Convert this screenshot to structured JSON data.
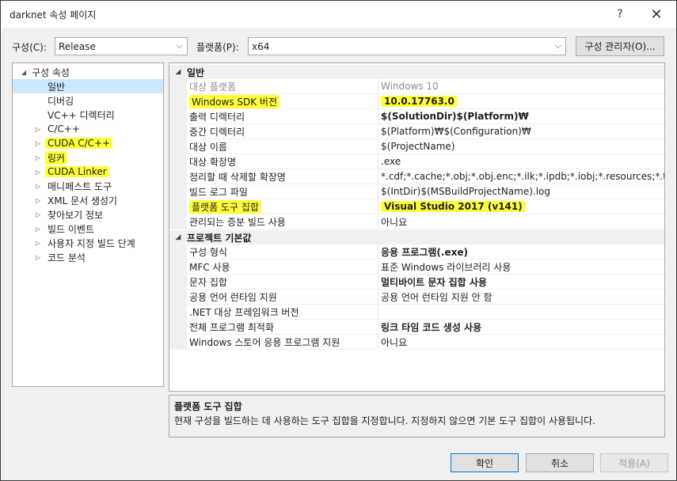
{
  "window": {
    "title": "darknet 속성 페이지",
    "help": "?",
    "close": "✕"
  },
  "config": {
    "config_label": "구성(C):",
    "config_value": "Release",
    "platform_label": "플랫폼(P):",
    "platform_value": "x64",
    "manager_button": "구성 관리자(O)..."
  },
  "tree": {
    "root": "구성 속성",
    "items": [
      {
        "label": "일반"
      },
      {
        "label": "디버깅"
      },
      {
        "label": "VC++ 디렉터리"
      },
      {
        "label": "C/C++"
      },
      {
        "label": "CUDA C/C++"
      },
      {
        "label": "링커"
      },
      {
        "label": "CUDA Linker"
      },
      {
        "label": "매니페스트 도구"
      },
      {
        "label": "XML 문서 생성기"
      },
      {
        "label": "찾아보기 정보"
      },
      {
        "label": "빌드 이벤트"
      },
      {
        "label": "사용자 지정 빌드 단계"
      },
      {
        "label": "코드 분석"
      }
    ]
  },
  "grid": {
    "categories": [
      {
        "name": "일반",
        "props": [
          {
            "name": "대상 플랫폼",
            "value": "Windows 10"
          },
          {
            "name": "Windows SDK 버전",
            "value": "10.0.17763.0"
          },
          {
            "name": "출력 디렉터리",
            "value": "$(SolutionDir)$(Platform)₩"
          },
          {
            "name": "중간 디렉터리",
            "value": "$(Platform)₩$(Configuration)₩"
          },
          {
            "name": "대상 이름",
            "value": "$(ProjectName)"
          },
          {
            "name": "대상 확장명",
            "value": ".exe"
          },
          {
            "name": "정리할 때 삭제할 확장명",
            "value": "*.cdf;*.cache;*.obj;*.obj.enc;*.ilk;*.ipdb;*.iobj;*.resources;*.tlb;*.tli;*.tl"
          },
          {
            "name": "빌드 로그 파일",
            "value": "$(IntDir)$(MSBuildProjectName).log"
          },
          {
            "name": "플랫폼 도구 집합",
            "value": "Visual Studio 2017 (v141)"
          },
          {
            "name": "관리되는 증분 빌드 사용",
            "value": "아니요"
          }
        ]
      },
      {
        "name": "프로젝트 기본값",
        "props": [
          {
            "name": "구성 형식",
            "value": "응용 프로그램(.exe)"
          },
          {
            "name": "MFC 사용",
            "value": "표준 Windows 라이브러리 사용"
          },
          {
            "name": "문자 집합",
            "value": "멀티바이트 문자 집합 사용"
          },
          {
            "name": "공용 언어 런타임 지원",
            "value": "공용 언어 런타임 지원 안 함"
          },
          {
            "name": ".NET 대상 프레임워크 버전",
            "value": ""
          },
          {
            "name": "전체 프로그램 최적화",
            "value": "링크 타임 코드 생성 사용"
          },
          {
            "name": "Windows 스토어 응용 프로그램 지원",
            "value": "아니요"
          }
        ]
      }
    ]
  },
  "description": {
    "title": "플랫폼 도구 집합",
    "text": "현재 구성을 빌드하는 데 사용하는 도구 집합을 지정합니다. 지정하지 않으면 기본 도구 집합이 사용됩니다."
  },
  "buttons": {
    "ok": "확인",
    "cancel": "취소",
    "apply": "적용(A)"
  },
  "colors": {
    "highlight": "#ffff3a",
    "selection": "#cce8ff"
  }
}
